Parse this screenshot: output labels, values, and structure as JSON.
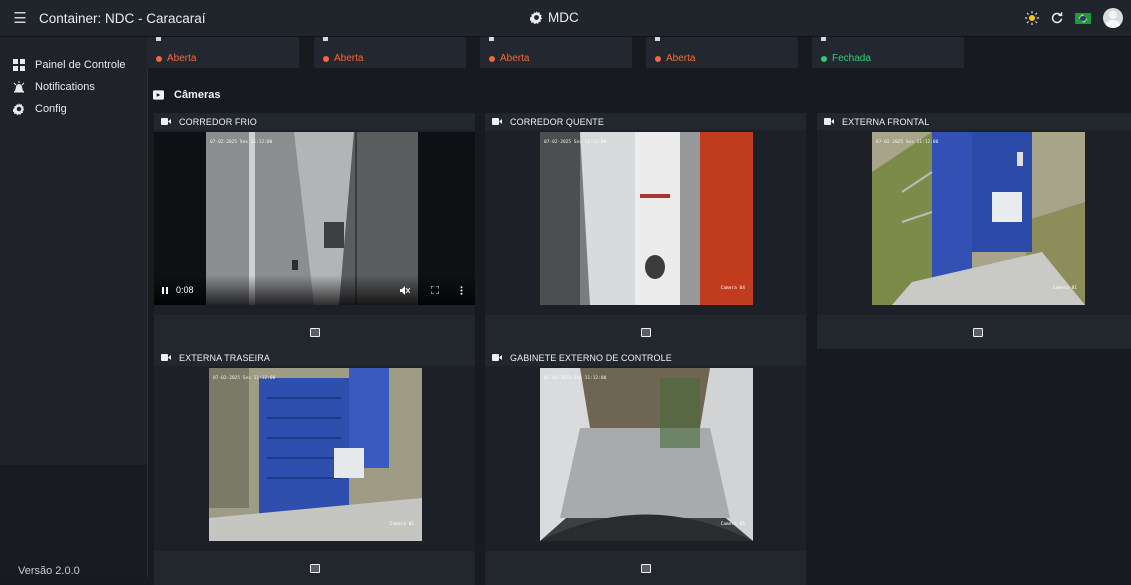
{
  "header": {
    "menu_icon": "menu-icon",
    "title": "Container: NDC - Caracaraí",
    "center_title": "MDC",
    "center_icon": "gear-icon",
    "actions": [
      "brightness-icon",
      "refresh-icon",
      "brazil-flag-icon",
      "user-avatar"
    ]
  },
  "sidebar": {
    "items": [
      {
        "label": "Painel de Controle",
        "icon": "dashboard-icon"
      },
      {
        "label": "Notifications",
        "icon": "alarm-icon"
      },
      {
        "label": "Config",
        "icon": "gear-icon"
      }
    ],
    "version": "Versão 2.0.0"
  },
  "doors": [
    {
      "status": "Aberta",
      "color": "#f5673a"
    },
    {
      "status": "Aberta",
      "color": "#f5673a"
    },
    {
      "status": "Aberta",
      "color": "#f5673a"
    },
    {
      "status": "Aberta",
      "color": "#f5673a"
    },
    {
      "status": "Fechada",
      "color": "#2ecc71"
    }
  ],
  "cameras_section": {
    "title": "Câmeras",
    "icon": "video-camera-icon"
  },
  "cameras": [
    {
      "name": "CORREDOR FRIO",
      "timestamp": "07-02-2025 Sex 11:12:00",
      "playing": true,
      "time": "0:08"
    },
    {
      "name": "CORREDOR QUENTE",
      "timestamp": "07-02-2025 Sex 11:12:00",
      "label": "Camera 04"
    },
    {
      "name": "EXTERNA FRONTAL",
      "timestamp": "07-02-2025 Sex 11:12:00",
      "label": "Camera 01"
    },
    {
      "name": "EXTERNA TRASEIRA",
      "timestamp": "07-02-2025 Sex 11:12:00",
      "label": "Camera 02"
    },
    {
      "name": "GABINETE EXTERNO DE CONTROLE",
      "timestamp": "07-02-2025 Sex 11:12:00",
      "label": "Camera 05"
    }
  ],
  "colors": {
    "background": "#171b20",
    "card": "#22272e",
    "open": "#f5673a",
    "closed": "#2ecc71"
  }
}
